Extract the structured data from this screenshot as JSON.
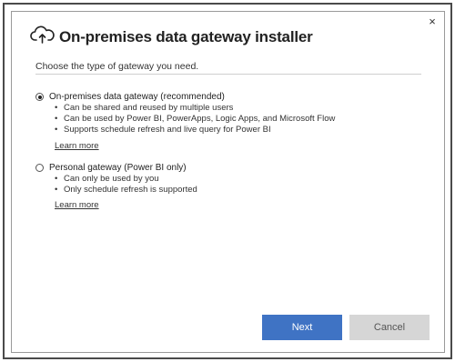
{
  "dialog": {
    "title": "On-premises data gateway installer",
    "close_label": "×",
    "subtitle": "Choose the type of gateway you need."
  },
  "options": [
    {
      "label": "On-premises data gateway (recommended)",
      "selected": true,
      "bullets": [
        "Can be shared and reused by multiple users",
        "Can be used by Power BI, PowerApps, Logic Apps, and Microsoft Flow",
        "Supports schedule refresh and live query for Power BI"
      ],
      "link": "Learn more"
    },
    {
      "label": "Personal gateway (Power BI only)",
      "selected": false,
      "bullets": [
        "Can only be used by you",
        "Only schedule refresh is supported"
      ],
      "link": "Learn more"
    }
  ],
  "buttons": {
    "next": "Next",
    "cancel": "Cancel"
  },
  "colors": {
    "primary_button": "#3f73c4",
    "secondary_button": "#d6d6d6"
  },
  "icons": {
    "title_icon": "cloud-upload-icon"
  }
}
